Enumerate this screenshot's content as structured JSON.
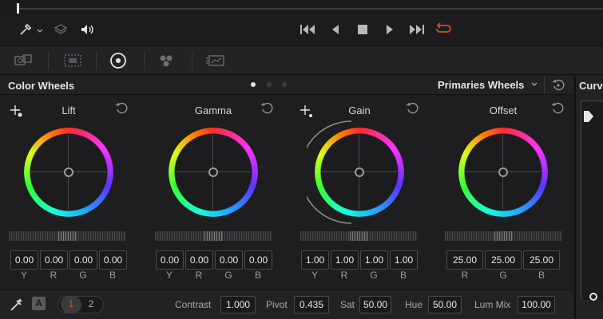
{
  "transport": {
    "icons": [
      "eyedropper-icon",
      "chevron-down-icon",
      "layers-icon",
      "volume-icon",
      "skip-back-icon",
      "step-back-icon",
      "stop-icon",
      "play-icon",
      "skip-forward-icon",
      "loop-icon"
    ]
  },
  "palette": {
    "icons": [
      "camera-raw-icon",
      "color-match-icon",
      "color-wheels-icon",
      "rgb-mixer-icon",
      "motion-effects-icon"
    ]
  },
  "panel": {
    "title": "Color Wheels",
    "mode": "Primaries Wheels",
    "side_title": "Curv"
  },
  "wheels": [
    {
      "label": "Lift",
      "values": [
        "0.00",
        "0.00",
        "0.00",
        "0.00"
      ],
      "channels": [
        "Y",
        "R",
        "G",
        "B"
      ]
    },
    {
      "label": "Gamma",
      "values": [
        "0.00",
        "0.00",
        "0.00",
        "0.00"
      ],
      "channels": [
        "Y",
        "R",
        "G",
        "B"
      ]
    },
    {
      "label": "Gain",
      "values": [
        "1.00",
        "1.00",
        "1.00",
        "1.00"
      ],
      "channels": [
        "Y",
        "R",
        "G",
        "B"
      ]
    },
    {
      "label": "Offset",
      "values": [
        "25.00",
        "25.00",
        "25.00"
      ],
      "channels": [
        "R",
        "G",
        "B"
      ]
    }
  ],
  "footer": {
    "auto_label": "A",
    "page1": "1",
    "page2": "2",
    "contrast_label": "Contrast",
    "contrast": "1.000",
    "pivot_label": "Pivot",
    "pivot": "0.435",
    "sat_label": "Sat",
    "sat": "50.00",
    "hue_label": "Hue",
    "hue": "50.00",
    "lummix_label": "Lum Mix",
    "lummix": "100.00"
  },
  "colors": {
    "accent_red": "#e0452a",
    "active_page_bg": "#3a3a3c"
  }
}
